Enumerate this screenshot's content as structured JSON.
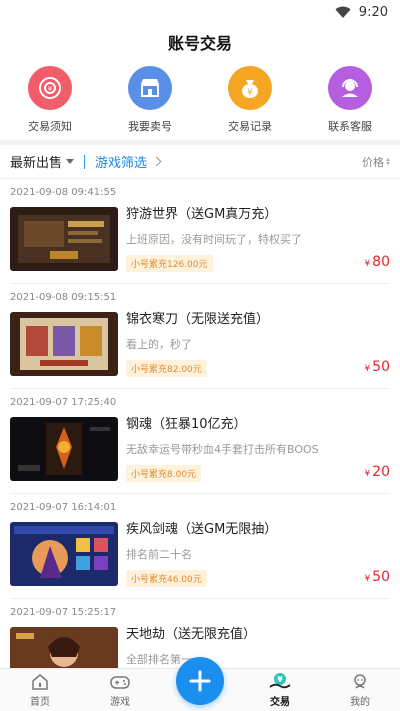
{
  "status": {
    "time": "9:20"
  },
  "header": {
    "title": "账号交易"
  },
  "quick_actions": [
    {
      "label": "交易须知",
      "icon": "notice-icon",
      "color": "#f25d6a"
    },
    {
      "label": "我要卖号",
      "icon": "shop-icon",
      "color": "#5a8fe8"
    },
    {
      "label": "交易记录",
      "icon": "money-bag-icon",
      "color": "#f5a623"
    },
    {
      "label": "联系客服",
      "icon": "customer-service-icon",
      "color": "#b55ee0"
    }
  ],
  "filter": {
    "latest": "最新出售",
    "game_filter": "游戏筛选",
    "price": "价格"
  },
  "listings": [
    {
      "date": "2021-09-08 09:41:55",
      "title": "狩游世界（送GM真万充）",
      "desc": "上班原因，没有时间玩了，特权买了",
      "tag": "小号累充126.00元",
      "price": "80",
      "currency": "¥"
    },
    {
      "date": "2021-09-08 09:15:51",
      "title": "锦衣寒刀（无限送充值）",
      "desc": "看上的，秒了",
      "tag": "小号累充82.00元",
      "price": "50",
      "currency": "¥"
    },
    {
      "date": "2021-09-07 17:25:40",
      "title": "钢魂（狂暴10亿充）",
      "desc": "无敌幸运号带秒血4手套打击所有BOOS",
      "tag": "小号累充8.00元",
      "price": "20",
      "currency": "¥"
    },
    {
      "date": "2021-09-07 16:14:01",
      "title": "疾风剑魂（送GM无限抽）",
      "desc": "排名前二十名",
      "tag": "小号累充46.00元",
      "price": "50",
      "currency": "¥"
    },
    {
      "date": "2021-09-07 15:25:17",
      "title": "天地劫（送无限充值）",
      "desc": "全部排名第一",
      "tag": "",
      "price": "",
      "currency": ""
    }
  ],
  "tabbar": [
    {
      "label": "首页",
      "icon": "home-icon"
    },
    {
      "label": "游戏",
      "icon": "gamepad-icon"
    },
    {
      "label": "",
      "icon": "plus-icon"
    },
    {
      "label": "交易",
      "icon": "trade-icon",
      "active": true
    },
    {
      "label": "我的",
      "icon": "profile-icon"
    }
  ]
}
